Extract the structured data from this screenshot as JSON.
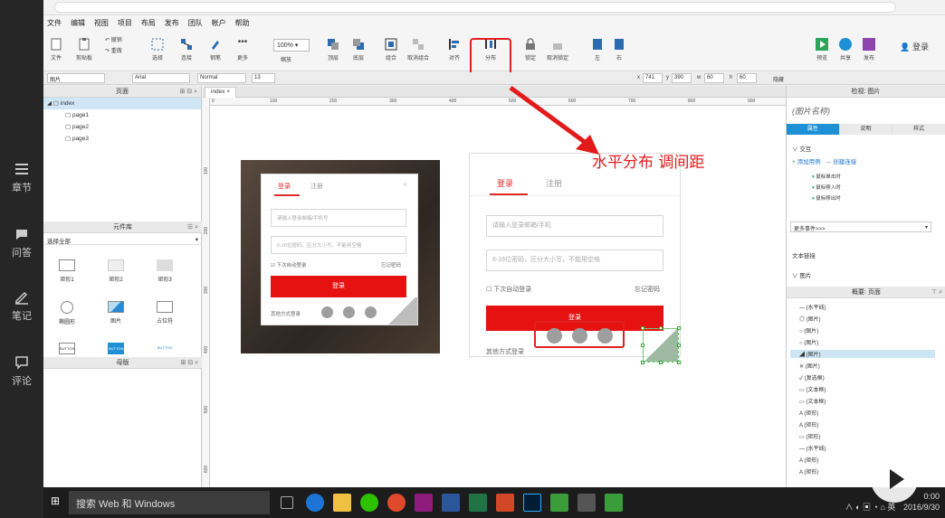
{
  "course_sidebar": {
    "items": [
      {
        "label": "章节",
        "icon": "stack-icon"
      },
      {
        "label": "问答",
        "icon": "chat-icon"
      },
      {
        "label": "笔记",
        "icon": "pencil-icon"
      },
      {
        "label": "评论",
        "icon": "comment-icon"
      }
    ]
  },
  "menubar": [
    "文件",
    "编辑",
    "视图",
    "项目",
    "布局",
    "发布",
    "团队",
    "帐户",
    "帮助"
  ],
  "toolbar": {
    "file_label": "文件",
    "clipboard_label": "剪贴板",
    "undo_label": "撤销",
    "redo_label": "重做",
    "select_label": "选择",
    "connect_label": "连接",
    "pen_label": "钢笔",
    "more_label": "更多",
    "zoom_value": "100%",
    "zoom_label": "缩放",
    "top_label": "顶层",
    "bottom_label": "底层",
    "group_label": "组合",
    "ungroup_label": "取消组合",
    "align_label": "对齐",
    "distribute_label": "分布",
    "lock_label": "锁定",
    "unlock_label": "取消锁定",
    "left_label": "左",
    "right_label": "右",
    "preview_label": "预览",
    "share_label": "共享",
    "publish_label": "发布",
    "login_label": "登录"
  },
  "formatbar": {
    "widget_type": "图片",
    "font": "Arial",
    "style": "Normal",
    "size": "13",
    "x_label": "x",
    "x_value": "741",
    "y_label": "y",
    "y_value": "390",
    "w_label": "w",
    "w_value": "60",
    "h_label": "h",
    "h_value": "60",
    "hidden_label": "隐藏"
  },
  "pages_panel": {
    "title": "页面",
    "root": "index",
    "children": [
      "page1",
      "page2",
      "page3"
    ]
  },
  "library_panel": {
    "title": "元件库",
    "selected": "选择全部",
    "widgets": [
      "矩形1",
      "矩形2",
      "矩形3",
      "椭圆形",
      "图片",
      "占位符",
      "BUTTON",
      "BUTTON",
      "BUTTON"
    ]
  },
  "masters_panel": {
    "title": "母版"
  },
  "canvas": {
    "tab": "index",
    "ruler_top": [
      "0",
      "100",
      "200",
      "300",
      "400",
      "500",
      "600",
      "700",
      "800",
      "900"
    ],
    "ruler_left": [
      "100",
      "200",
      "300",
      "400",
      "500",
      "600"
    ],
    "annotation": "水平分布 调间距"
  },
  "mock_small": {
    "tab_login": "登录",
    "tab_register": "注册",
    "input_phone": "请输入登录邮箱/手机号",
    "input_pwd": "6-16位密码，区分大小写，不能用空格",
    "auto_login": "下次自动登录",
    "forgot": "忘记密码",
    "button": "登录",
    "other": "其他方式登录"
  },
  "mock_large": {
    "tab_login": "登录",
    "tab_register": "注册",
    "input_phone": "请输入登录邮箱/手机",
    "input_pwd": "6-16位密码，区分大小写，不能用空格",
    "auto_login": "下次自动登录",
    "forgot": "忘记密码",
    "button": "登录",
    "other": "其他方式登录"
  },
  "inspector": {
    "title": "检视: 图片",
    "name_placeholder": "(图片名称)",
    "tabs": [
      "属性",
      "说明",
      "样式"
    ],
    "section_interaction": "交互",
    "add_case": "添加用例",
    "create_link": "创建连接",
    "events": [
      "鼠标单击时",
      "鼠标移入时",
      "鼠标移出时"
    ],
    "more_events": "更多事件>>>",
    "text_link": "文本链接",
    "image_section": "图片"
  },
  "outline": {
    "title": "概要: 页面",
    "items": [
      "(水平线)",
      "(图片)",
      "(图片)",
      "(图片)",
      "(图片)",
      "(图片)",
      "(复选框)",
      "(文本框)",
      "(文本框)",
      "(矩形)",
      "(矩形)",
      "(矩形)",
      "(水平线)",
      "(矩形)",
      "(矩形)"
    ]
  },
  "taskbar": {
    "search": "搜索 Web 和 Windows",
    "tray_time": "0:00",
    "tray_date": "2016/9/30",
    "ime": "英"
  }
}
